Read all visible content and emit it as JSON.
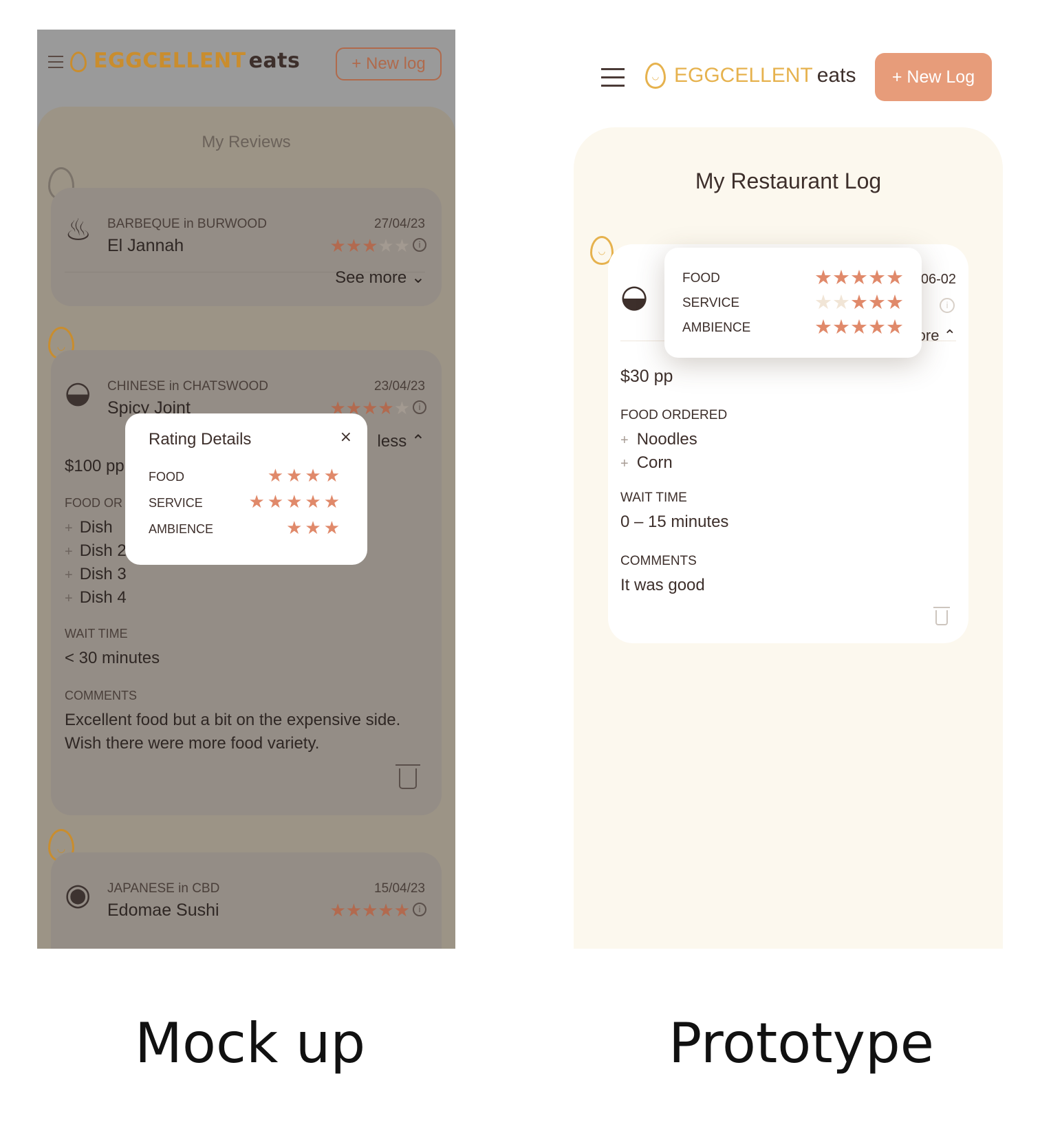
{
  "captions": {
    "left": "Mock up",
    "right": "Prototype"
  },
  "colors": {
    "accent": "#e79c7a",
    "brand": "#e6b24e",
    "panel": "#fcf8ee",
    "star": "#e0896a"
  },
  "mockup": {
    "logo": {
      "brand": "EGGCELLENT",
      "suffix": "eats"
    },
    "new_log_label": "+ New log",
    "panel_title": "My Reviews",
    "cards": [
      {
        "category": "BARBEQUE in BURWOOD",
        "name": "El Jannah",
        "date": "27/04/23",
        "rating": 3,
        "toggle_label": "See more",
        "icon": "bbq-grill-icon"
      },
      {
        "category": "CHINESE in CHATSWOOD",
        "name": "Spicy Joint",
        "date": "23/04/23",
        "rating": 4,
        "toggle_label": "less",
        "price": "$100 pp",
        "food_ordered_label": "FOOD OR",
        "dishes": [
          "Dish",
          "Dish 2",
          "Dish 3",
          "Dish 4"
        ],
        "wait_time_label": "WAIT TIME",
        "wait_time": "< 30 minutes",
        "comments_label": "COMMENTS",
        "comment_line1": "Excellent food but a bit on the expensive side.",
        "comment_line2": "Wish there were more food variety.",
        "icon": "dumpling-icon"
      },
      {
        "category": "JAPANESE in CBD",
        "name": "Edomae Sushi",
        "date": "15/04/23",
        "rating": 5,
        "icon": "sushi-icon"
      }
    ],
    "rating_modal": {
      "title": "Rating Details",
      "close": "×",
      "rows": [
        {
          "label": "FOOD",
          "stars": 4
        },
        {
          "label": "SERVICE",
          "stars": 5
        },
        {
          "label": "AMBIENCE",
          "stars": 3
        }
      ]
    }
  },
  "prototype": {
    "logo": {
      "brand": "EGGCELLENT",
      "suffix": "eats"
    },
    "new_log_label": "+ New Log",
    "panel_title": "My Restaurant Log",
    "card": {
      "date": "06-02",
      "toggle_label": "ore",
      "price": "$30 pp",
      "food_ordered_label": "FOOD ORDERED",
      "dishes": [
        "Noodles",
        "Corn"
      ],
      "wait_time_label": "WAIT TIME",
      "wait_time": "0 – 15 minutes",
      "comments_label": "COMMENTS",
      "comment": "It was good",
      "icon": "dumpling-icon"
    },
    "rating_popover": {
      "rows": [
        {
          "label": "FOOD",
          "stars": 5
        },
        {
          "label": "SERVICE",
          "stars": 3,
          "empty": 2
        },
        {
          "label": "AMBIENCE",
          "stars": 5
        }
      ]
    }
  }
}
